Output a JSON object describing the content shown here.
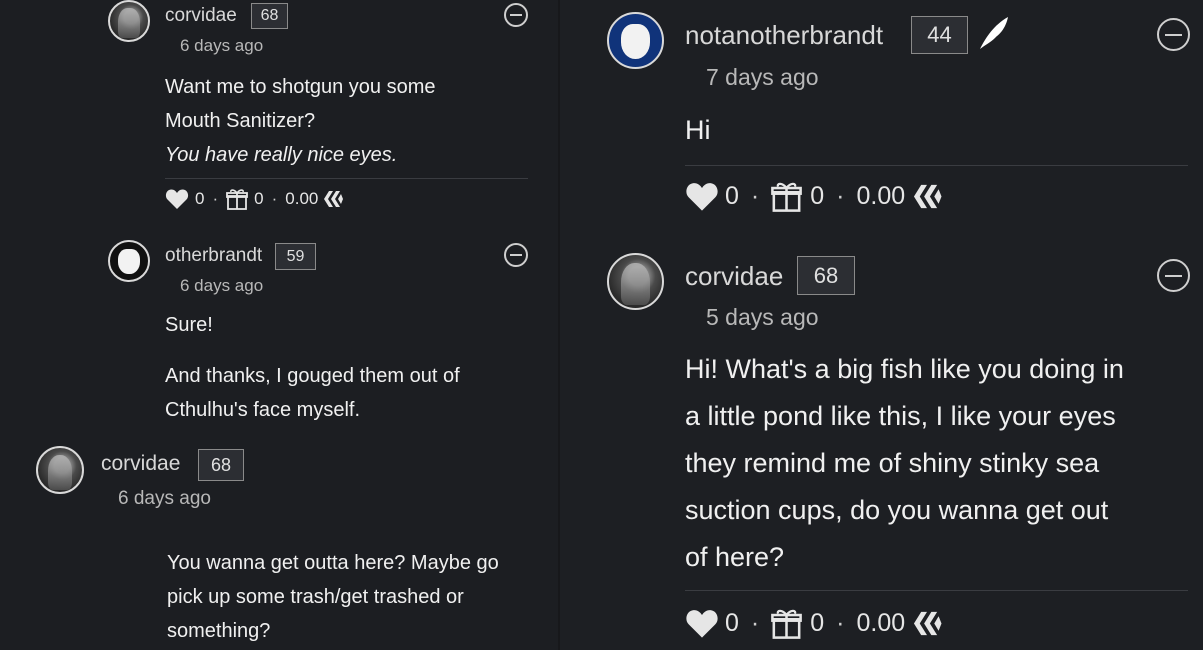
{
  "left": {
    "c1": {
      "username": "corvidae",
      "reputation": "68",
      "time": "6 days ago",
      "lines": [
        "Want me to shotgun you some",
        "Mouth Sanitizer?",
        "You have really nice eyes."
      ],
      "votes": "0",
      "gifts": "0",
      "payout": "0.00"
    },
    "c2": {
      "username": "otherbrandt",
      "reputation": "59",
      "time": "6 days ago",
      "para1": "Sure!",
      "para2_lines": [
        "And thanks, I gouged them out of",
        "Cthulhu's face myself."
      ]
    },
    "c3": {
      "username": "corvidae",
      "reputation": "68",
      "time": "6 days ago",
      "lines": [
        "You wanna get outta here? Maybe go",
        "pick up some trash/get trashed or",
        "something?"
      ]
    }
  },
  "right": {
    "c1": {
      "username": "notanotherbrandt",
      "reputation": "44",
      "time": "7 days ago",
      "body": "Hi",
      "votes": "0",
      "gifts": "0",
      "payout": "0.00"
    },
    "c2": {
      "username": "corvidae",
      "reputation": "68",
      "time": "5 days ago",
      "lines": [
        "Hi! What's a big fish like you doing in",
        "a little pond like this, I like your eyes",
        "they remind me of shiny stinky sea",
        "suction cups, do you wanna get out",
        "of here?"
      ],
      "votes": "0",
      "gifts": "0",
      "payout": "0.00"
    }
  },
  "actions": {
    "separator": "·"
  },
  "icons": {
    "heart": "heart-icon",
    "gift": "gift-icon",
    "hive": "hive-icon",
    "collapse": "minus-circle-icon",
    "feather": "feather-icon"
  }
}
